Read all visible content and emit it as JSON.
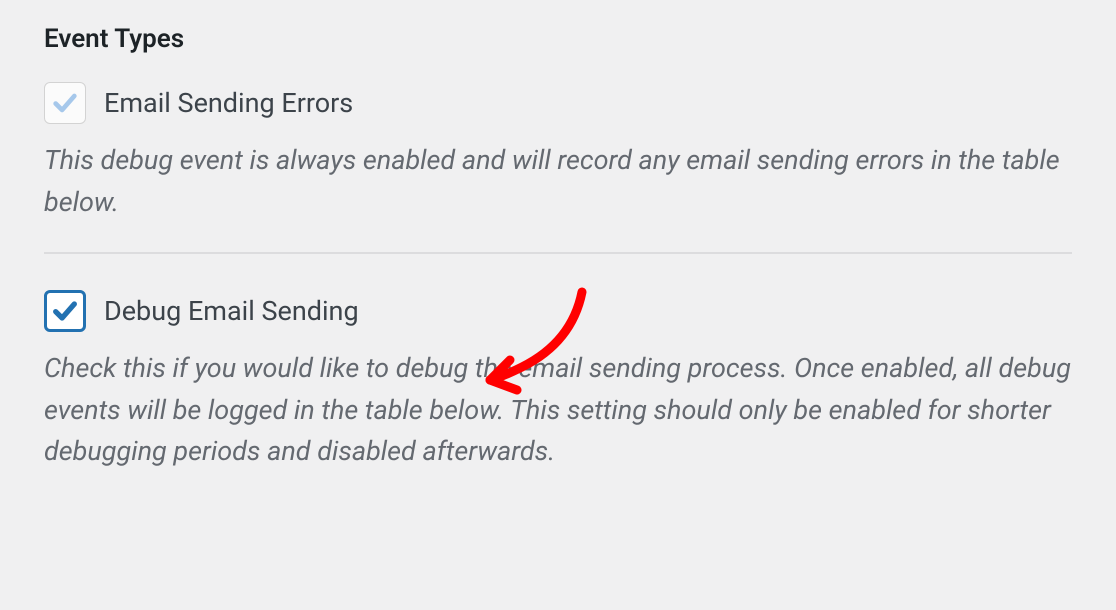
{
  "section": {
    "heading": "Event Types"
  },
  "options": [
    {
      "label": "Email Sending Errors",
      "description": "This debug event is always enabled and will record any email sending errors in the table below.",
      "checked": true,
      "disabled": true
    },
    {
      "label": "Debug Email Sending",
      "description": "Check this if you would like to debug the email sending process. Once enabled, all debug events will be logged in the table below. This setting should only be enabled for shorter debugging periods and disabled afterwards.",
      "checked": true,
      "disabled": false
    }
  ]
}
